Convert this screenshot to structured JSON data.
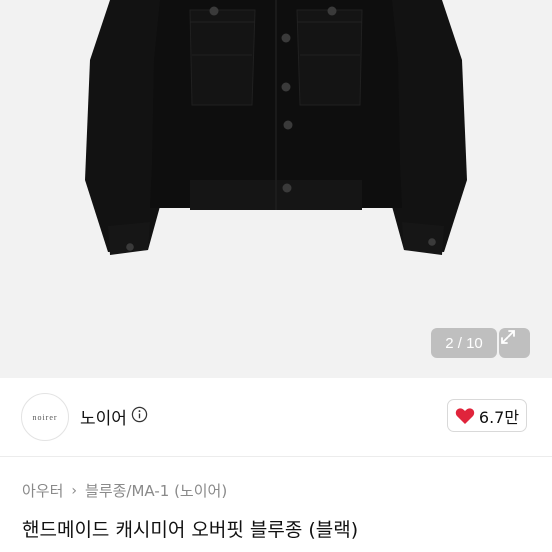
{
  "gallery": {
    "counter": "2 / 10",
    "expand_icon": "expand-arrows-icon",
    "background": "#f2f2f2",
    "jacket_color": "#111111"
  },
  "seller": {
    "avatar_text": "noirer",
    "name": "노이어",
    "info_icon": "info-icon",
    "like_icon": "heart-icon",
    "like_color": "#e0243b",
    "like_count": "6.7만"
  },
  "breadcrumb": {
    "items": [
      "아우터",
      "블루종/MA-1 (노이어)"
    ]
  },
  "product": {
    "title": "핸드메이드 캐시미어 오버핏 블루종 (블랙)"
  }
}
